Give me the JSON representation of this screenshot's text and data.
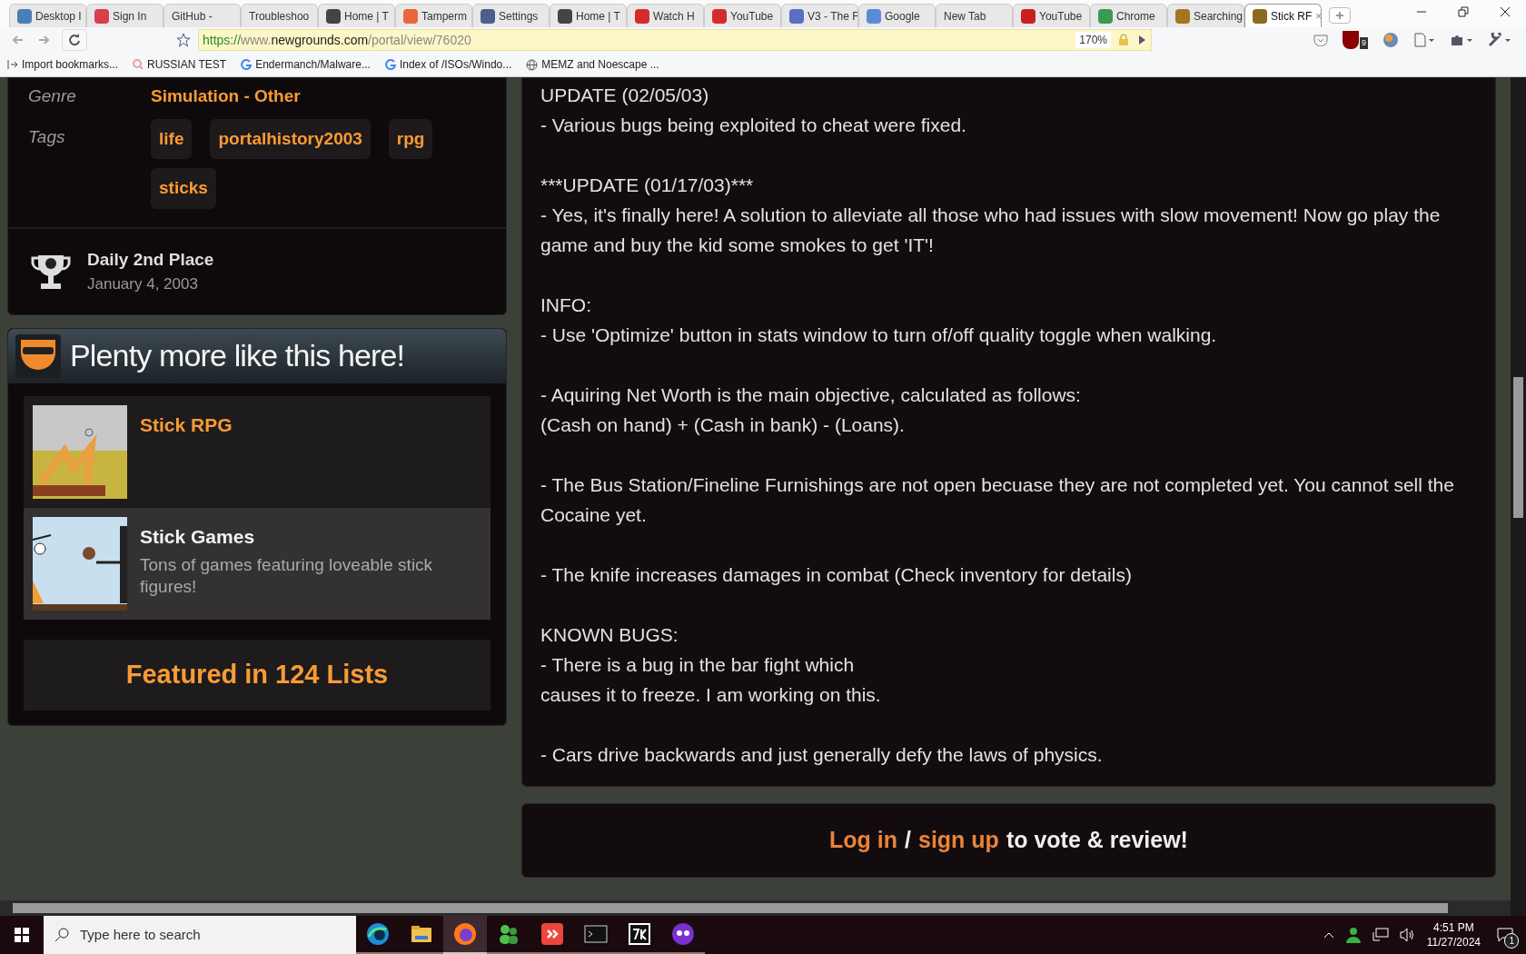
{
  "browser": {
    "tabs": [
      {
        "title": "Desktop I",
        "color": "#4a7fb5",
        "selected": false
      },
      {
        "title": "Sign In",
        "color": "#d9404a",
        "selected": false
      },
      {
        "title": "GitHub -",
        "selected": false
      },
      {
        "title": "Troubleshoo",
        "selected": false
      },
      {
        "title": "Home | T",
        "color": "#444444",
        "selected": false
      },
      {
        "title": "Tamperm",
        "color": "#e8663a",
        "selected": false
      },
      {
        "title": "Settings",
        "color": "#4a5f8a",
        "selected": false
      },
      {
        "title": "Home | T",
        "color": "#444444",
        "selected": false
      },
      {
        "title": "Watch H",
        "color": "#d42c2c",
        "selected": false
      },
      {
        "title": "YouTube",
        "color": "#d42c2c",
        "selected": false
      },
      {
        "title": "V3 - The F",
        "color": "#5a6fc4",
        "selected": false
      },
      {
        "title": "Google",
        "color": "#5a8ad8",
        "selected": false
      },
      {
        "title": "New Tab",
        "selected": false
      },
      {
        "title": "YouTube",
        "color": "#c82020",
        "selected": false
      },
      {
        "title": "Chrome",
        "color": "#3a9a50",
        "selected": false
      },
      {
        "title": "Searching",
        "color": "#a5741e",
        "selected": false
      },
      {
        "title": "Stick RF",
        "color": "#8a6a1e",
        "selected": true,
        "close": "×"
      }
    ],
    "url": [
      {
        "text": "https://",
        "kind": "scheme"
      },
      {
        "text": "www.",
        "kind": "muted"
      },
      {
        "text": "newgrounds.com",
        "kind": "domain"
      },
      {
        "text": "/portal/view/76020",
        "kind": "muted"
      }
    ],
    "zoom": "170%",
    "extension_badge": "9",
    "bookmarks": [
      "Import bookmarks...",
      "RUSSIAN TEST",
      "Endermanch/Malware...",
      "Index of /ISOs/Windo...",
      "MEMZ and Noescape ..."
    ]
  },
  "page": {
    "genre": {
      "label": "Genre",
      "value": "Simulation - Other"
    },
    "tags": {
      "label": "Tags",
      "items": [
        "life",
        "portalhistory2003",
        "rpg",
        "sticks"
      ]
    },
    "award": {
      "title": "Daily 2nd Place",
      "date": "January 4, 2003"
    },
    "related": {
      "title": "Plenty more like this here!",
      "items": [
        {
          "title": "Stick RPG",
          "selected": false
        },
        {
          "title": "Stick Games",
          "description": "Tons of games featuring loveable stick figures!",
          "selected": true
        }
      ],
      "featured": "Featured in 124 Lists"
    },
    "description": [
      [
        "UPDATE (02/05/03)",
        "- Various bugs being exploited to cheat were fixed."
      ],
      [
        "***UPDATE (01/17/03)***",
        "- Yes, it's finally here! A solution to alleviate all those who had issues with slow movement! Now go play the game and buy the kid some smokes to get 'IT'!"
      ],
      [
        "INFO:",
        "- Use 'Optimize' button in stats window to turn of/off quality toggle when walking."
      ],
      [
        "- Aquiring Net Worth is the main objective, calculated as follows:",
        "(Cash on hand) + (Cash in bank) - (Loans)."
      ],
      [
        "- The Bus Station/Fineline Furnishings are not open becuase they are not completed yet. You cannot sell the Cocaine yet."
      ],
      [
        "- The knife increases damages in combat (Check inventory for details)"
      ],
      [
        "KNOWN BUGS:",
        "- There is a bug in the bar fight which",
        "causes it to freeze. I am working on this."
      ],
      [
        "- Cars drive backwards and just generally defy the laws of physics."
      ]
    ],
    "login": {
      "login_link": "Log in",
      "separator": "/",
      "signup_link": "sign up",
      "suffix": "to vote & review!"
    }
  },
  "taskbar": {
    "search_placeholder": "Type here to search",
    "apps": [
      {
        "selected": false
      },
      {
        "selected": false
      },
      {
        "selected": true
      },
      {
        "selected": false
      },
      {
        "selected": false
      },
      {
        "selected": false
      },
      {
        "selected": false
      },
      {
        "selected": false
      }
    ],
    "time": "4:51 PM",
    "date": "11/27/2024",
    "notifications": "1"
  }
}
